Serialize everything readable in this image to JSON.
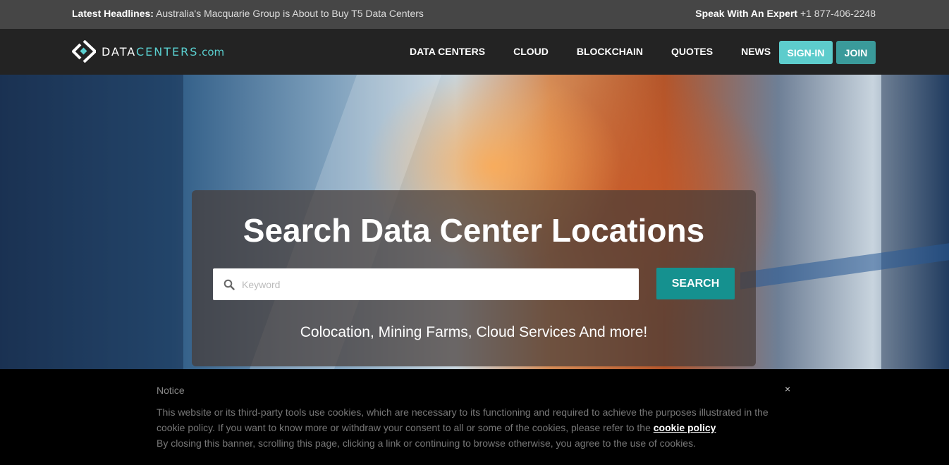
{
  "topbar": {
    "headline_label": "Latest Headlines:",
    "headline_text": "Australia's Macquarie Group is About to Buy T5 Data Centers",
    "expert_label": "Speak With An Expert",
    "phone": "+1 877-406-2248"
  },
  "logo": {
    "part1": "DATA",
    "part2": "CENTERS",
    "part3": ".com"
  },
  "nav": {
    "items": [
      "DATA CENTERS",
      "CLOUD",
      "BLOCKCHAIN",
      "QUOTES",
      "NEWS"
    ],
    "signin": "SIGN-IN",
    "join": "JOIN"
  },
  "hero": {
    "title": "Search Data Center Locations",
    "search_placeholder": "Keyword",
    "search_button": "SEARCH",
    "subtitle": "Colocation, Mining Farms, Cloud Services And more!"
  },
  "notice": {
    "title": "Notice",
    "close": "×",
    "line1": "This website or its third-party tools use cookies, which are necessary to its functioning and required to achieve the purposes illustrated in the cookie policy. If you want to know more or withdraw your consent to all or some of the cookies, please refer to the",
    "link": "cookie policy",
    "line2": "By closing this banner, scrolling this page, clicking a link or continuing to browse otherwise, you agree to the use of cookies."
  },
  "colors": {
    "accent": "#5dcccc",
    "join": "#3a9a9a",
    "search_button": "#15918f"
  },
  "icons": {
    "search": "search-icon",
    "logo": "logo-diamond-icon"
  }
}
